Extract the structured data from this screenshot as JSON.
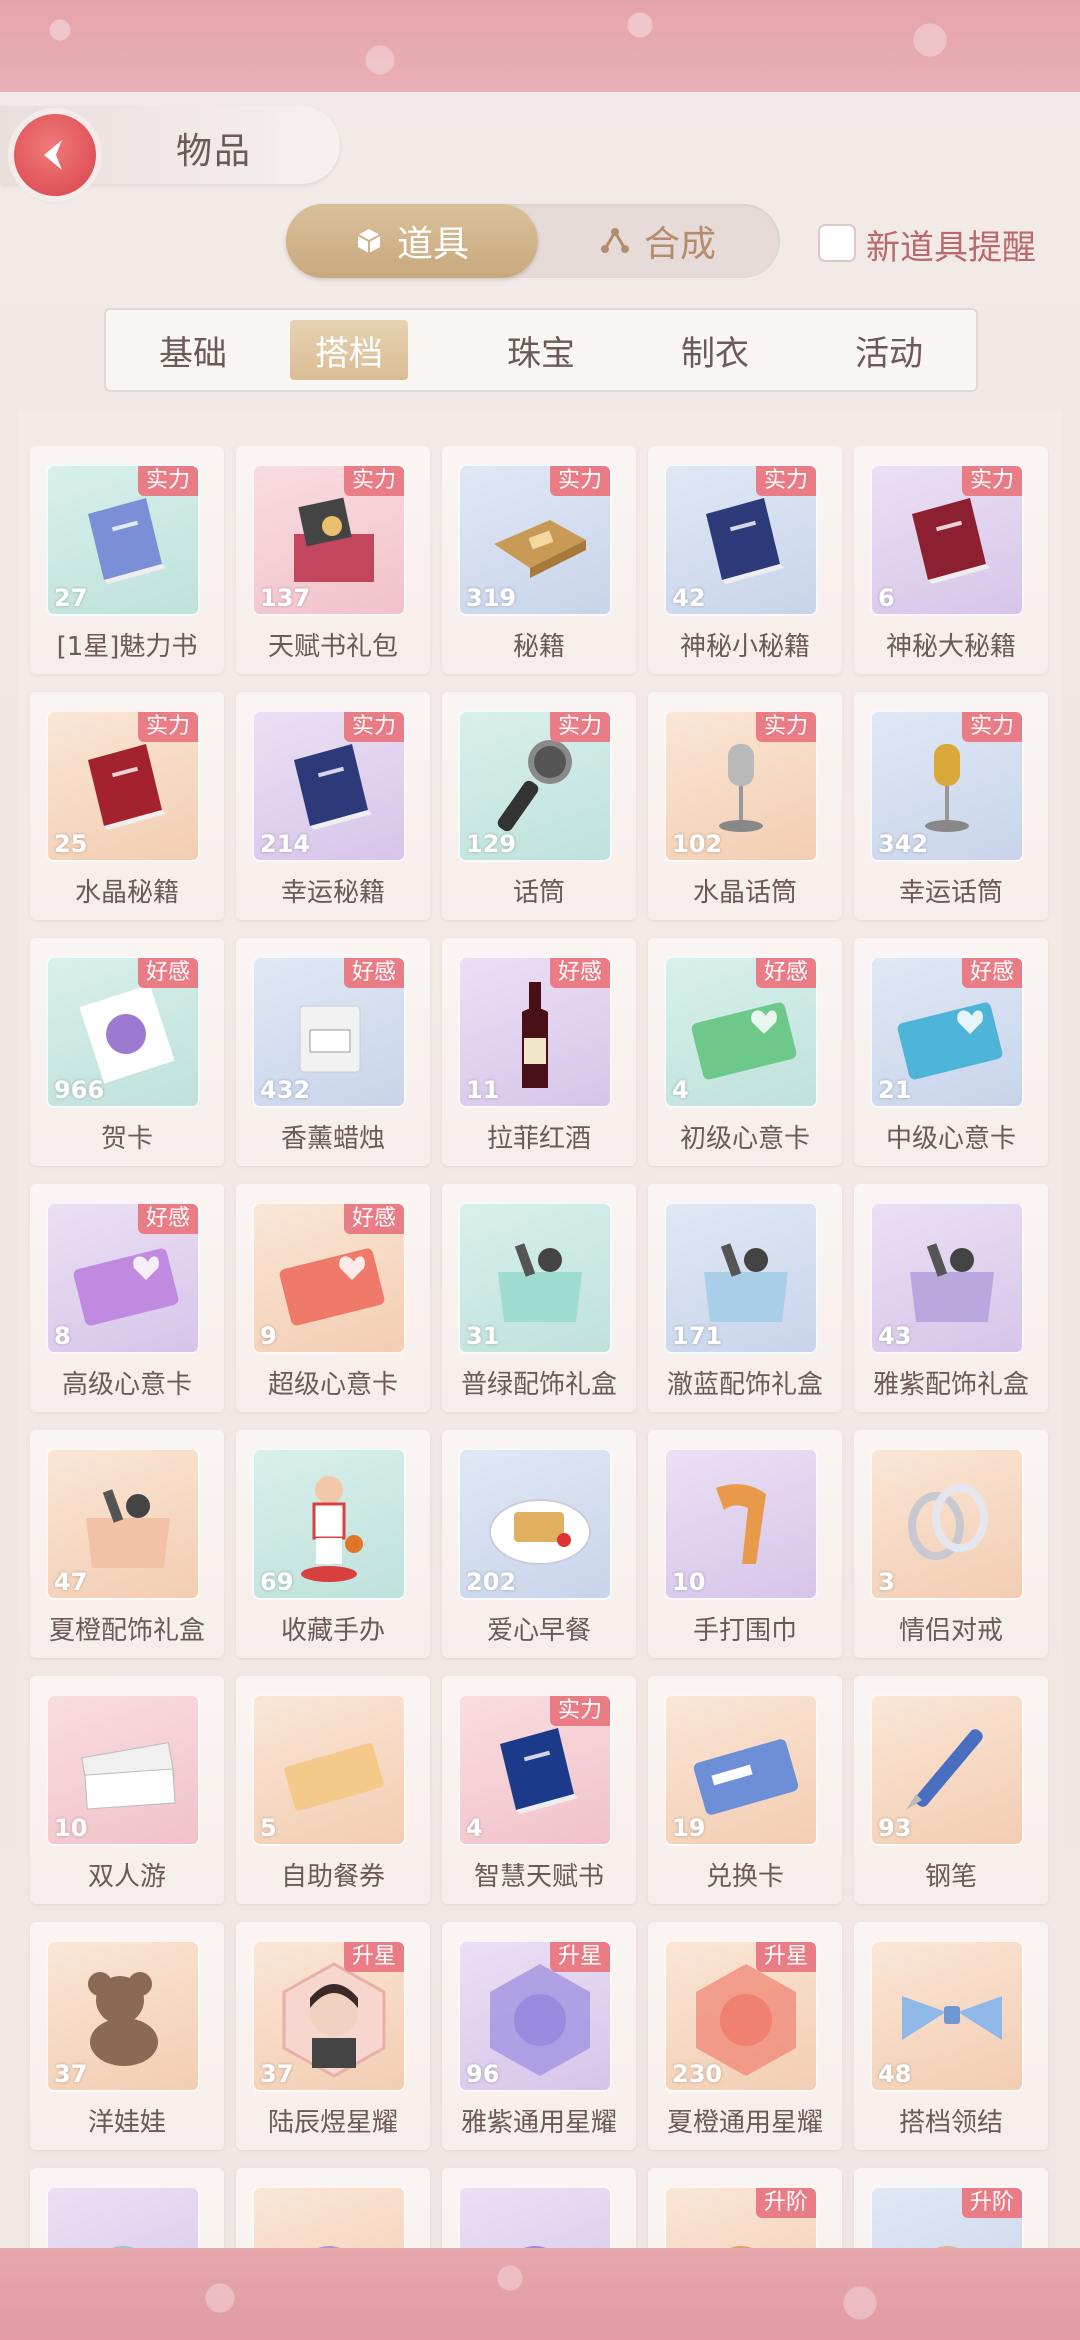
{
  "header": {
    "title": "物品"
  },
  "segments": {
    "active": "道具",
    "inactive": "合成"
  },
  "notify": {
    "label": "新道具提醒",
    "checked": false
  },
  "tabs": [
    {
      "label": "基础",
      "active": false
    },
    {
      "label": "搭档",
      "active": true
    },
    {
      "label": "珠宝",
      "active": false
    },
    {
      "label": "制衣",
      "active": false
    },
    {
      "label": "活动",
      "active": false
    }
  ],
  "items": [
    {
      "name": "[1星]魅力书",
      "count": "27",
      "badge": "实力",
      "bg": "teal",
      "icon": "book-icon",
      "color": "#7b8fd6"
    },
    {
      "name": "天赋书礼包",
      "count": "137",
      "badge": "实力",
      "bg": "pink",
      "icon": "gift-box-icon",
      "color": "#c2475c"
    },
    {
      "name": "秘籍",
      "count": "319",
      "badge": "实力",
      "bg": "blue",
      "icon": "scroll-book-icon",
      "color": "#c99a55"
    },
    {
      "name": "神秘小秘籍",
      "count": "42",
      "badge": "实力",
      "bg": "blue",
      "icon": "book-icon",
      "color": "#2d3a7a"
    },
    {
      "name": "神秘大秘籍",
      "count": "6",
      "badge": "实力",
      "bg": "purple",
      "icon": "book-icon",
      "color": "#8d2030"
    },
    {
      "name": "水晶秘籍",
      "count": "25",
      "badge": "实力",
      "bg": "orange",
      "icon": "book-icon",
      "color": "#a3222e"
    },
    {
      "name": "幸运秘籍",
      "count": "214",
      "badge": "实力",
      "bg": "purple",
      "icon": "book-icon",
      "color": "#2d3a7a"
    },
    {
      "name": "话筒",
      "count": "129",
      "badge": "实力",
      "bg": "teal",
      "icon": "microphone-icon",
      "color": "#333333"
    },
    {
      "name": "水晶话筒",
      "count": "102",
      "badge": "实力",
      "bg": "orange",
      "icon": "stand-microphone-icon",
      "color": "#b9b9b9"
    },
    {
      "name": "幸运话筒",
      "count": "342",
      "badge": "实力",
      "bg": "blue",
      "icon": "stand-microphone-icon",
      "color": "#d8a93a"
    },
    {
      "name": "贺卡",
      "count": "966",
      "badge": "好感",
      "bg": "teal",
      "icon": "greeting-card-icon",
      "color": "#9b7ad0"
    },
    {
      "name": "香薰蜡烛",
      "count": "432",
      "badge": "好感",
      "bg": "blue",
      "icon": "candle-icon",
      "color": "#f2f2f2"
    },
    {
      "name": "拉菲红酒",
      "count": "11",
      "badge": "好感",
      "bg": "purple",
      "icon": "wine-bottle-icon",
      "color": "#4a1018"
    },
    {
      "name": "初级心意卡",
      "count": "4",
      "badge": "好感",
      "bg": "teal",
      "icon": "heart-card-icon",
      "color": "#6cc98a"
    },
    {
      "name": "中级心意卡",
      "count": "21",
      "badge": "好感",
      "bg": "blue",
      "icon": "heart-card-icon",
      "color": "#4fb5d8"
    },
    {
      "name": "高级心意卡",
      "count": "8",
      "badge": "好感",
      "bg": "purple",
      "icon": "heart-card-icon",
      "color": "#c08ae0"
    },
    {
      "name": "超级心意卡",
      "count": "9",
      "badge": "好感",
      "bg": "orange",
      "icon": "heart-card-icon",
      "color": "#f07a6a"
    },
    {
      "name": "普绿配饰礼盒",
      "count": "31",
      "badge": "",
      "bg": "teal",
      "icon": "accessory-bag-icon",
      "color": "#9fdcd0"
    },
    {
      "name": "澈蓝配饰礼盒",
      "count": "171",
      "badge": "",
      "bg": "blue",
      "icon": "accessory-bag-icon",
      "color": "#a9cfe8"
    },
    {
      "name": "雅紫配饰礼盒",
      "count": "43",
      "badge": "",
      "bg": "purple",
      "icon": "accessory-bag-icon",
      "color": "#b9a7e0"
    },
    {
      "name": "夏橙配饰礼盒",
      "count": "47",
      "badge": "",
      "bg": "orange",
      "icon": "accessory-bag-icon",
      "color": "#f3c1a5"
    },
    {
      "name": "收藏手办",
      "count": "69",
      "badge": "",
      "bg": "teal",
      "icon": "figurine-icon",
      "color": "#d84040"
    },
    {
      "name": "爱心早餐",
      "count": "202",
      "badge": "",
      "bg": "blue",
      "icon": "breakfast-plate-icon",
      "color": "#e0b060"
    },
    {
      "name": "手打围巾",
      "count": "10",
      "badge": "",
      "bg": "purple",
      "icon": "scarf-icon",
      "color": "#e89a4a"
    },
    {
      "name": "情侣对戒",
      "count": "3",
      "badge": "",
      "bg": "orange",
      "icon": "rings-icon",
      "color": "#c8c8d0"
    },
    {
      "name": "双人游",
      "count": "10",
      "badge": "",
      "bg": "pink",
      "icon": "tickets-icon",
      "color": "#f0f0f0"
    },
    {
      "name": "自助餐券",
      "count": "5",
      "badge": "",
      "bg": "orange",
      "icon": "coupon-icon",
      "color": "#f5c98a"
    },
    {
      "name": "智慧天赋书",
      "count": "4",
      "badge": "实力",
      "bg": "pink",
      "icon": "book-icon",
      "color": "#1b3a8a"
    },
    {
      "name": "兑换卡",
      "count": "19",
      "badge": "",
      "bg": "orange",
      "icon": "exchange-card-icon",
      "color": "#6d8fd8"
    },
    {
      "name": "钢笔",
      "count": "93",
      "badge": "",
      "bg": "orange",
      "icon": "fountain-pen-icon",
      "color": "#4a6fc0"
    },
    {
      "name": "洋娃娃",
      "count": "37",
      "badge": "",
      "bg": "orange",
      "icon": "teddy-bear-icon",
      "color": "#8b6a55"
    },
    {
      "name": "陆辰煜星耀",
      "count": "37",
      "badge": "升星",
      "bg": "orange",
      "icon": "portrait-icon",
      "color": "#c9a7a0"
    },
    {
      "name": "雅紫通用星耀",
      "count": "96",
      "badge": "升星",
      "bg": "purple",
      "icon": "hexagon-gem-icon",
      "color": "#9a8ae0"
    },
    {
      "name": "夏橙通用星耀",
      "count": "230",
      "badge": "升星",
      "bg": "orange",
      "icon": "hexagon-gem-icon",
      "color": "#f08070"
    },
    {
      "name": "搭档领结",
      "count": "48",
      "badge": "",
      "bg": "orange",
      "icon": "bowtie-icon",
      "color": "#8fb8e8"
    },
    {
      "name": "",
      "count": "",
      "badge": "",
      "bg": "purple",
      "icon": "partial-item-icon",
      "color": "#7fc7c0"
    },
    {
      "name": "",
      "count": "",
      "badge": "",
      "bg": "orange",
      "icon": "partial-item-icon",
      "color": "#9a8ad0"
    },
    {
      "name": "",
      "count": "",
      "badge": "",
      "bg": "purple",
      "icon": "partial-item-icon",
      "color": "#8a7ac8"
    },
    {
      "name": "",
      "count": "",
      "badge": "升阶",
      "bg": "orange",
      "icon": "partial-item-icon",
      "color": "#e0904a"
    },
    {
      "name": "",
      "count": "",
      "badge": "升阶",
      "bg": "blue",
      "icon": "partial-item-icon",
      "color": "#d8b070"
    }
  ]
}
